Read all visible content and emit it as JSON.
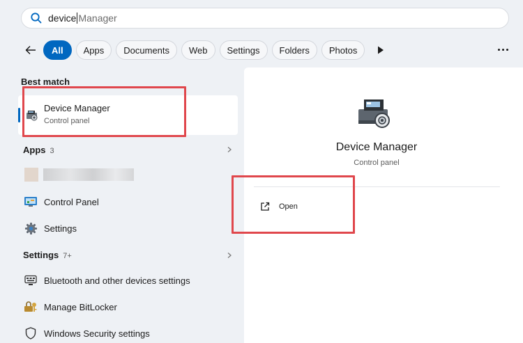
{
  "search": {
    "typed": "device",
    "suggestion": "Manager"
  },
  "filters": [
    {
      "label": "All",
      "active": true
    },
    {
      "label": "Apps",
      "active": false
    },
    {
      "label": "Documents",
      "active": false
    },
    {
      "label": "Web",
      "active": false
    },
    {
      "label": "Settings",
      "active": false
    },
    {
      "label": "Folders",
      "active": false
    },
    {
      "label": "Photos",
      "active": false
    }
  ],
  "results": {
    "best_match_header": "Best match",
    "best_match": {
      "title": "Device Manager",
      "subtitle": "Control panel",
      "icon": "device-manager-icon"
    },
    "apps_header": "Apps",
    "apps_count": "3",
    "apps": [
      {
        "label": "",
        "icon": "blurred-app-icon"
      },
      {
        "label": "Control Panel",
        "icon": "control-panel-icon"
      },
      {
        "label": "Settings",
        "icon": "settings-gear-icon"
      }
    ],
    "settings_header": "Settings",
    "settings_count": "7+",
    "settings": [
      {
        "label": "Bluetooth and other devices settings",
        "icon": "bluetooth-devices-icon"
      },
      {
        "label": "Manage BitLocker",
        "icon": "bitlocker-icon"
      },
      {
        "label": "Windows Security settings",
        "icon": "shield-icon"
      }
    ]
  },
  "detail": {
    "title": "Device Manager",
    "subtitle": "Control panel",
    "open_label": "Open"
  },
  "colors": {
    "accent": "#0067c0",
    "highlight": "#e0474c"
  }
}
